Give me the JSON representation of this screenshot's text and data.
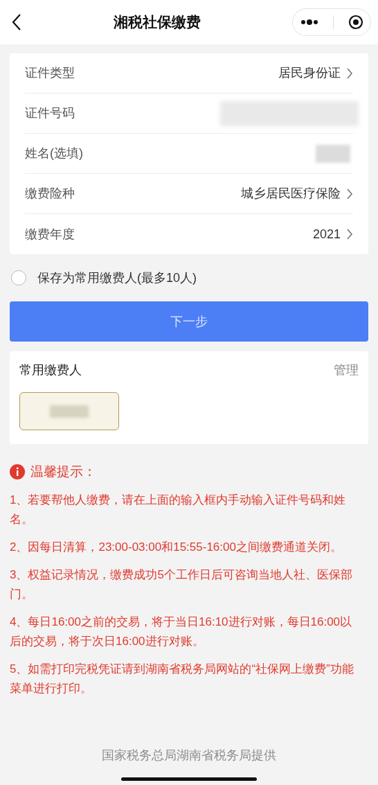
{
  "header": {
    "title": "湘税社保缴费"
  },
  "form": [
    {
      "kind": "select",
      "label": "证件类型",
      "value": "居民身份证"
    },
    {
      "kind": "masked",
      "label": "证件号码"
    },
    {
      "kind": "masked_short",
      "label": "姓名(选填)"
    },
    {
      "kind": "select",
      "label": "缴费险种",
      "value": "城乡居民医疗保险"
    },
    {
      "kind": "select",
      "label": "缴费年度",
      "value": "2021"
    }
  ],
  "save_payer": {
    "label": "保存为常用缴费人(最多10人)",
    "checked": false
  },
  "next_button": "下一步",
  "frequent": {
    "title": "常用缴费人",
    "manage": "管理"
  },
  "tips": {
    "title": "温馨提示：",
    "items": [
      "1、若要帮他人缴费，请在上面的输入框内手动输入证件号码和姓名。",
      "2、因每日清算，23:00-03:00和15:55-16:00之间缴费通道关闭。",
      "3、权益记录情况，缴费成功5个工作日后可咨询当地人社、医保部门。",
      "4、每日16:00之前的交易，将于当日16:10进行对账，每日16:00以后的交易，将于次日16:00进行对账。",
      "5、如需打印完税凭证请到湖南省税务局网站的“社保网上缴费”功能菜单进行打印。"
    ]
  },
  "footer": "国家税务总局湖南省税务局提供"
}
